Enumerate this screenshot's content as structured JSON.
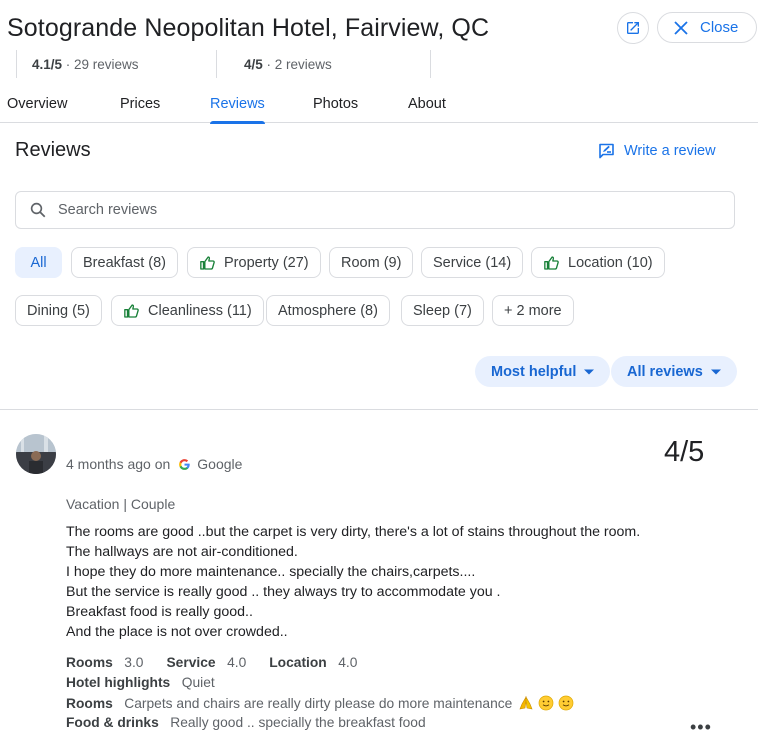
{
  "header": {
    "title": "Sotogrande Neopolitan Hotel, Fairview, QC",
    "close_label": "Close"
  },
  "rating_strip": [
    {
      "score": "4.1/5",
      "count": "29 reviews"
    },
    {
      "score": "4/5",
      "count": "2 reviews"
    }
  ],
  "tabs": [
    "Overview",
    "Prices",
    "Reviews",
    "Photos",
    "About"
  ],
  "active_tab": "Reviews",
  "reviews_section": {
    "heading": "Reviews",
    "write_review_label": "Write a review",
    "search_placeholder": "Search reviews"
  },
  "chips_row1": [
    {
      "label": "All",
      "selected": true,
      "icon": ""
    },
    {
      "label": "Breakfast (8)",
      "icon": ""
    },
    {
      "label": "Property (27)",
      "icon": "thumbs-up-icon"
    },
    {
      "label": "Room (9)",
      "icon": ""
    },
    {
      "label": "Service (14)",
      "icon": ""
    },
    {
      "label": "Location (10)",
      "icon": "thumbs-up-icon"
    }
  ],
  "chips_row2": [
    {
      "label": "Dining (5)",
      "icon": ""
    },
    {
      "label": "Cleanliness (11)",
      "icon": "thumbs-up-icon"
    },
    {
      "label": "Atmosphere (8)",
      "icon": ""
    },
    {
      "label": "Sleep (7)",
      "icon": ""
    },
    {
      "label": "+ 2 more",
      "icon": ""
    }
  ],
  "sort": {
    "order_label": "Most helpful",
    "filter_label": "All reviews"
  },
  "review": {
    "time_ago": "4 months ago on",
    "source": "Google",
    "score": "4/5",
    "trip_type": "Vacation | Couple",
    "body_lines": [
      "The rooms are good ..but the carpet is very dirty, there's a lot of stains throughout the room.",
      "The hallways are not air-conditioned.",
      "I hope they do more maintenance.. specially the chairs,carpets....",
      "But the service is really good .. they always try to accommodate you .",
      "Breakfast food is really good..",
      "And the place is not over crowded.."
    ],
    "ratings": {
      "rooms_label": "Rooms",
      "rooms_value": "3.0",
      "service_label": "Service",
      "service_value": "4.0",
      "location_label": "Location",
      "location_value": "4.0"
    },
    "highlights_label": "Hotel highlights",
    "highlights_value": "Quiet",
    "rooms_note_label": "Rooms",
    "rooms_note_value": "Carpets and chairs are really dirty please do more maintenance",
    "food_label": "Food & drinks",
    "food_value": "Really good .. specially the breakfast food",
    "more_label": "•••"
  },
  "colors": {
    "accent": "#1a73e8",
    "chip_selected_bg": "#e8f0fe",
    "thumbs_up": "#188038",
    "border": "#dadce0"
  }
}
